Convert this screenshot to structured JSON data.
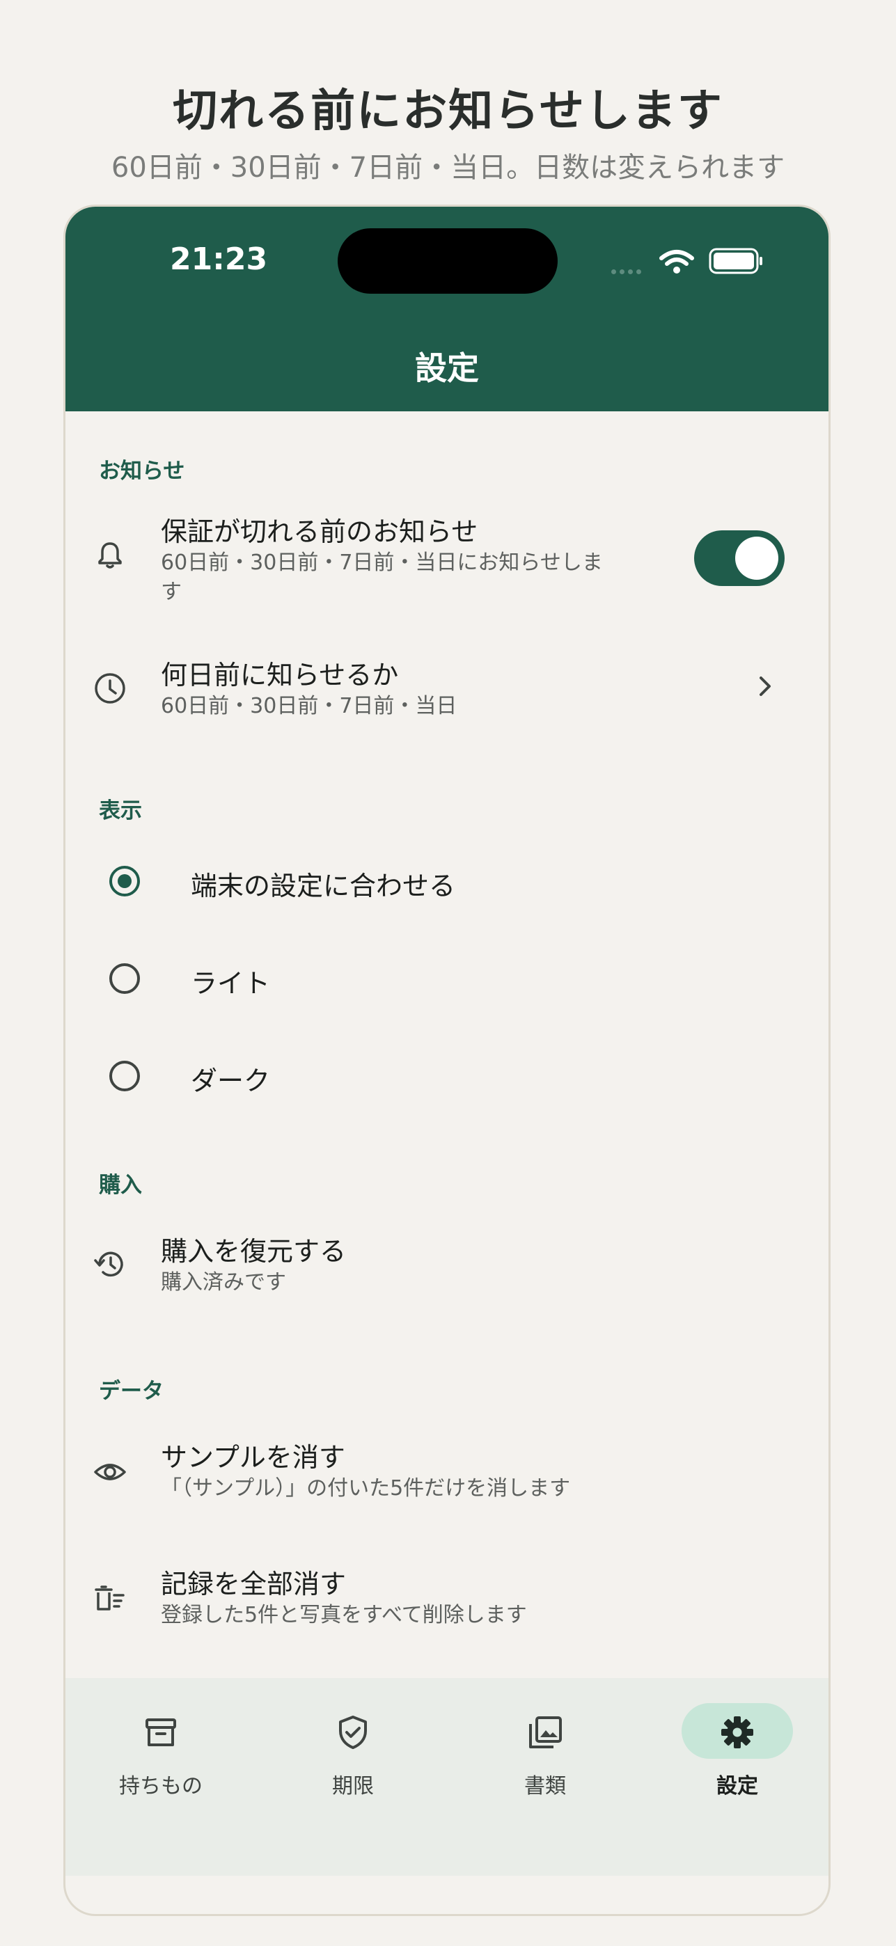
{
  "promo": {
    "headline": "切れる前にお知らせします",
    "subline": "60日前・30日前・7日前・当日。日数は変えられます"
  },
  "status_bar": {
    "time": "21:23"
  },
  "app_bar": {
    "title": "設定"
  },
  "sections": {
    "notifications": {
      "header": "お知らせ",
      "warranty": {
        "title": "保証が切れる前のお知らせ",
        "subtitle_line1": "60日前・30日前・7日前・当日にお知らせしま",
        "subtitle_line2": "す",
        "enabled": true
      },
      "days_before": {
        "title": "何日前に知らせるか",
        "subtitle": "60日前・30日前・7日前・当日"
      }
    },
    "display": {
      "header": "表示",
      "options": [
        {
          "label": "端末の設定に合わせる",
          "selected": true
        },
        {
          "label": "ライト",
          "selected": false
        },
        {
          "label": "ダーク",
          "selected": false
        }
      ]
    },
    "purchase": {
      "header": "購入",
      "restore": {
        "title": "購入を復元する",
        "subtitle": "購入済みです"
      }
    },
    "data": {
      "header": "データ",
      "clear_samples": {
        "title": "サンプルを消す",
        "subtitle": "「（サンプル）」の付いた5件だけを消します"
      },
      "delete_all": {
        "title": "記録を全部消す",
        "subtitle": "登録した5件と写真をすべて削除します"
      }
    }
  },
  "bottom_nav": {
    "items": [
      {
        "label": "持ちもの",
        "icon": "archive-icon",
        "active": false
      },
      {
        "label": "期限",
        "icon": "shield-check-icon",
        "active": false
      },
      {
        "label": "書類",
        "icon": "photo-library-icon",
        "active": false
      },
      {
        "label": "設定",
        "icon": "gear-icon",
        "active": true
      }
    ]
  },
  "colors": {
    "primary": "#1f5c4b",
    "background": "#f4f2ee",
    "nav_background": "#e9ede8",
    "active_pill": "#c7e6d8"
  }
}
